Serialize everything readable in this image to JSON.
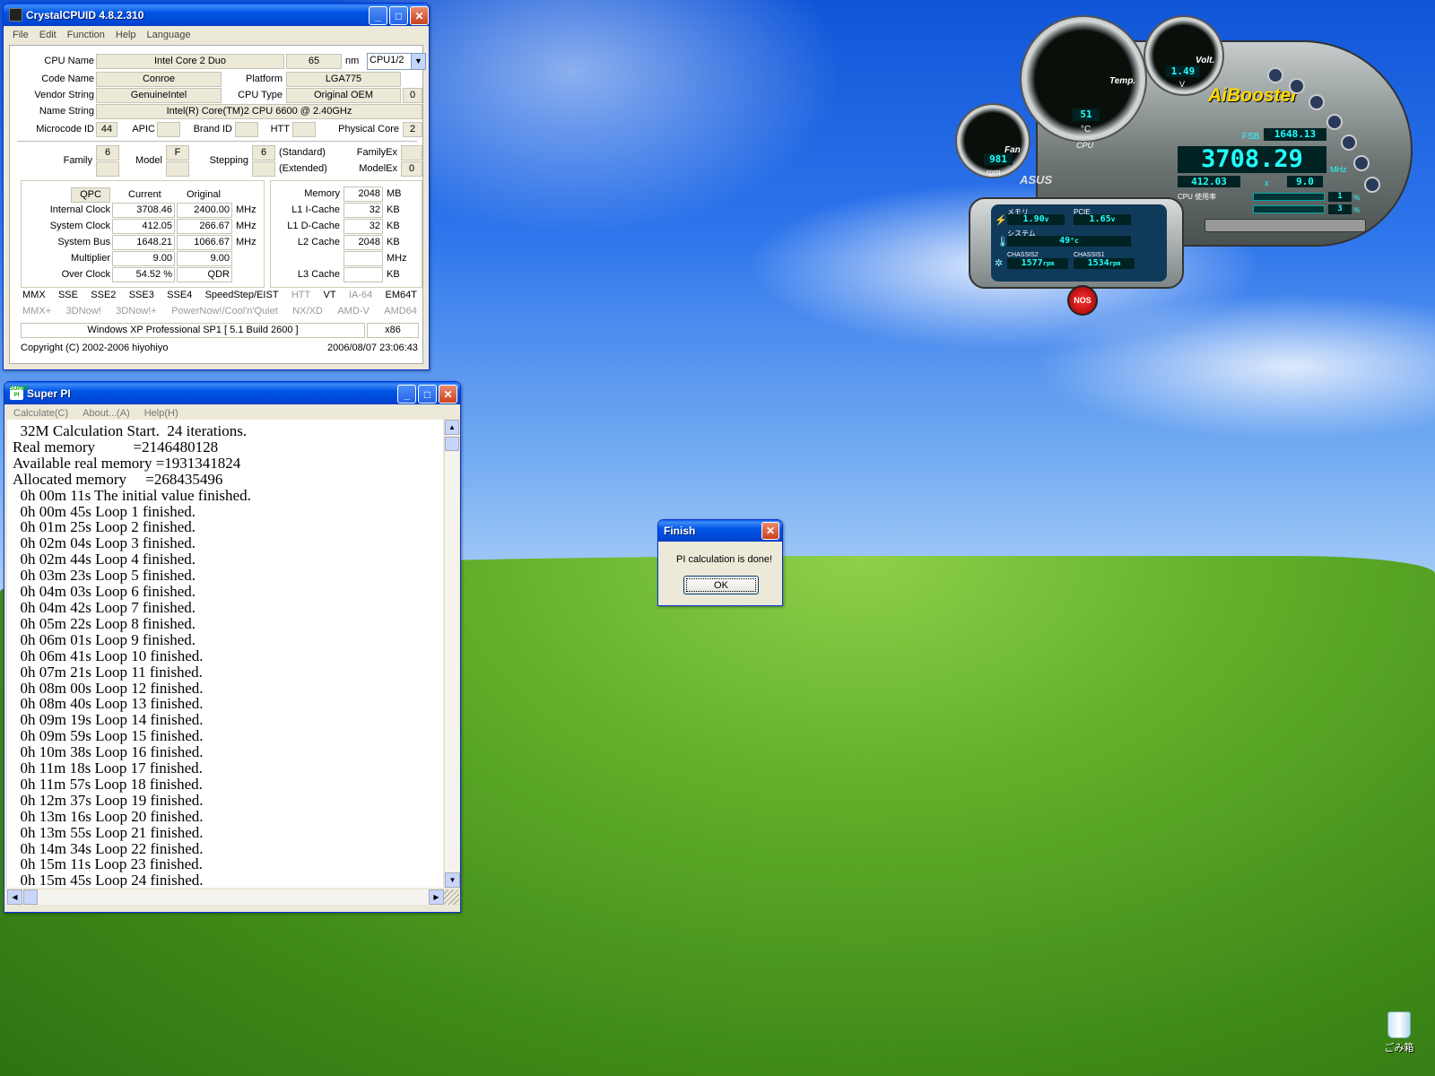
{
  "crystal": {
    "title": "CrystalCPUID 4.8.2.310",
    "menu": [
      "File",
      "Edit",
      "Function",
      "Help",
      "Language"
    ],
    "labels": {
      "cpu_name": "CPU Name",
      "code_name": "Code Name",
      "platform": "Platform",
      "vendor": "Vendor String",
      "cpu_type": "CPU Type",
      "name_string": "Name String",
      "microcode": "Microcode ID",
      "apic": "APIC",
      "brand": "Brand ID",
      "htt": "HTT",
      "phys_core": "Physical Core",
      "family": "Family",
      "model": "Model",
      "stepping": "Stepping",
      "standard": "(Standard)",
      "extended": "(Extended)",
      "family_ex": "FamilyEx",
      "model_ex": "ModelEx",
      "nm": "nm"
    },
    "values": {
      "cpu_name": "Intel Core 2 Duo",
      "nm": "65",
      "cpu_select": "CPU1/2",
      "code_name": "Conroe",
      "platform": "LGA775",
      "vendor": "GenuineIntel",
      "cpu_type": "Original OEM",
      "cpu_type_num": "0",
      "name_string": "Intel(R) Core(TM)2 CPU          6600  @ 2.40GHz",
      "microcode": "44",
      "apic": "",
      "brand": "",
      "htt": "",
      "phys_core": "2",
      "family": "6",
      "model": "F",
      "stepping": "6",
      "family_ex": "",
      "model_ex": "0"
    },
    "clock_headers": {
      "qpc": "QPC",
      "current": "Current",
      "original": "Original"
    },
    "clocks": [
      {
        "label": "Internal Clock",
        "current": "3708.46",
        "original": "2400.00",
        "unit": "MHz"
      },
      {
        "label": "System Clock",
        "current": "412.05",
        "original": "266.67",
        "unit": "MHz"
      },
      {
        "label": "System Bus",
        "current": "1648.21",
        "original": "1066.67",
        "unit": "MHz"
      },
      {
        "label": "Multiplier",
        "current": "9.00",
        "original": "9.00",
        "unit": ""
      },
      {
        "label": "Over Clock",
        "current": "54.52 %",
        "original": "QDR",
        "unit": ""
      }
    ],
    "memory": [
      {
        "label": "Memory",
        "value": "2048",
        "unit": "MB"
      },
      {
        "label": "L1 I-Cache",
        "value": "32",
        "unit": "KB"
      },
      {
        "label": "L1 D-Cache",
        "value": "32",
        "unit": "KB"
      },
      {
        "label": "L2 Cache",
        "value": "2048",
        "unit": "KB"
      },
      {
        "label": "",
        "value": "",
        "unit": "MHz"
      },
      {
        "label": "L3 Cache",
        "value": "",
        "unit": "KB"
      }
    ],
    "features_row1": [
      {
        "name": "MMX",
        "on": true
      },
      {
        "name": "SSE",
        "on": true
      },
      {
        "name": "SSE2",
        "on": true
      },
      {
        "name": "SSE3",
        "on": true
      },
      {
        "name": "SSE4",
        "on": true
      },
      {
        "name": "SpeedStep/EIST",
        "on": true
      },
      {
        "name": "HTT",
        "on": false
      },
      {
        "name": "VT",
        "on": true
      },
      {
        "name": "IA-64",
        "on": false
      },
      {
        "name": "EM64T",
        "on": true
      }
    ],
    "features_row2": [
      {
        "name": "MMX+",
        "on": false
      },
      {
        "name": "3DNow!",
        "on": false
      },
      {
        "name": "3DNow!+",
        "on": false
      },
      {
        "name": "PowerNow!/Cool'n'Quiet",
        "on": false
      },
      {
        "name": "NX/XD",
        "on": false
      },
      {
        "name": "AMD-V",
        "on": false
      },
      {
        "name": "AMD64",
        "on": false
      }
    ],
    "os": "Windows XP Professional SP1 [ 5.1 Build 2600 ]",
    "arch": "x86",
    "copyright": "Copyright (C) 2002-2006 hiyohiyo",
    "date": "2006/08/07 23:06:43"
  },
  "superpi": {
    "title": "Super PI",
    "icon_text": "SUPER PI",
    "menu": [
      "Calculate(C)",
      "About...(A)",
      "Help(H)"
    ],
    "lines": [
      "  32M Calculation Start.  24 iterations.",
      "Real memory          =2146480128",
      "Available real memory =1931341824",
      "Allocated memory     =268435496",
      "  0h 00m 11s The initial value finished.",
      "  0h 00m 45s Loop 1 finished.",
      "  0h 01m 25s Loop 2 finished.",
      "  0h 02m 04s Loop 3 finished.",
      "  0h 02m 44s Loop 4 finished.",
      "  0h 03m 23s Loop 5 finished.",
      "  0h 04m 03s Loop 6 finished.",
      "  0h 04m 42s Loop 7 finished.",
      "  0h 05m 22s Loop 8 finished.",
      "  0h 06m 01s Loop 9 finished.",
      "  0h 06m 41s Loop 10 finished.",
      "  0h 07m 21s Loop 11 finished.",
      "  0h 08m 00s Loop 12 finished.",
      "  0h 08m 40s Loop 13 finished.",
      "  0h 09m 19s Loop 14 finished.",
      "  0h 09m 59s Loop 15 finished.",
      "  0h 10m 38s Loop 16 finished.",
      "  0h 11m 18s Loop 17 finished.",
      "  0h 11m 57s Loop 18 finished.",
      "  0h 12m 37s Loop 19 finished.",
      "  0h 13m 16s Loop 20 finished.",
      "  0h 13m 55s Loop 21 finished.",
      "  0h 14m 34s Loop 22 finished.",
      "  0h 15m 11s Loop 23 finished.",
      "  0h 15m 45s Loop 24 finished."
    ]
  },
  "finish": {
    "title": "Finish",
    "message": "PI calculation is done!",
    "ok": "OK"
  },
  "aibooster": {
    "brand": "AiBooster",
    "asus": "ASUS",
    "temp_label": "Temp.",
    "temp_unit": "°C",
    "temp_value": "51",
    "cpu_label": "CPU",
    "volt_label": "Volt.",
    "volt_value": "1.49",
    "volt_unit": "V",
    "fan_label": "Fan",
    "fan_value": "981",
    "fan_unit": "rpm",
    "fsb_label": "FSB",
    "fsb_value": "1648.13",
    "cpu_mhz": "3708.29",
    "mhz_unit": "MHz",
    "clock_base": "412.03",
    "mult": "9.0",
    "x": "x",
    "cpu_usage_label": "CPU 使用率",
    "usage_1": "1",
    "usage_2": "3",
    "percent": "%",
    "mem_label": "メモリ",
    "pcie_label": "PCIE",
    "mem_v": "1.90",
    "pcie_v": "1.65",
    "v_unit": "v",
    "sys_label": "システム",
    "sys_temp": "49",
    "c_unit": "°c",
    "ch2_label": "CHASSIS2",
    "ch1_label": "CHASSIS1",
    "ch2_rpm": "1577",
    "ch1_rpm": "1534",
    "rpm": "rpm",
    "nos": "NOS"
  },
  "desktop": {
    "recycle_label": "ごみ箱"
  }
}
